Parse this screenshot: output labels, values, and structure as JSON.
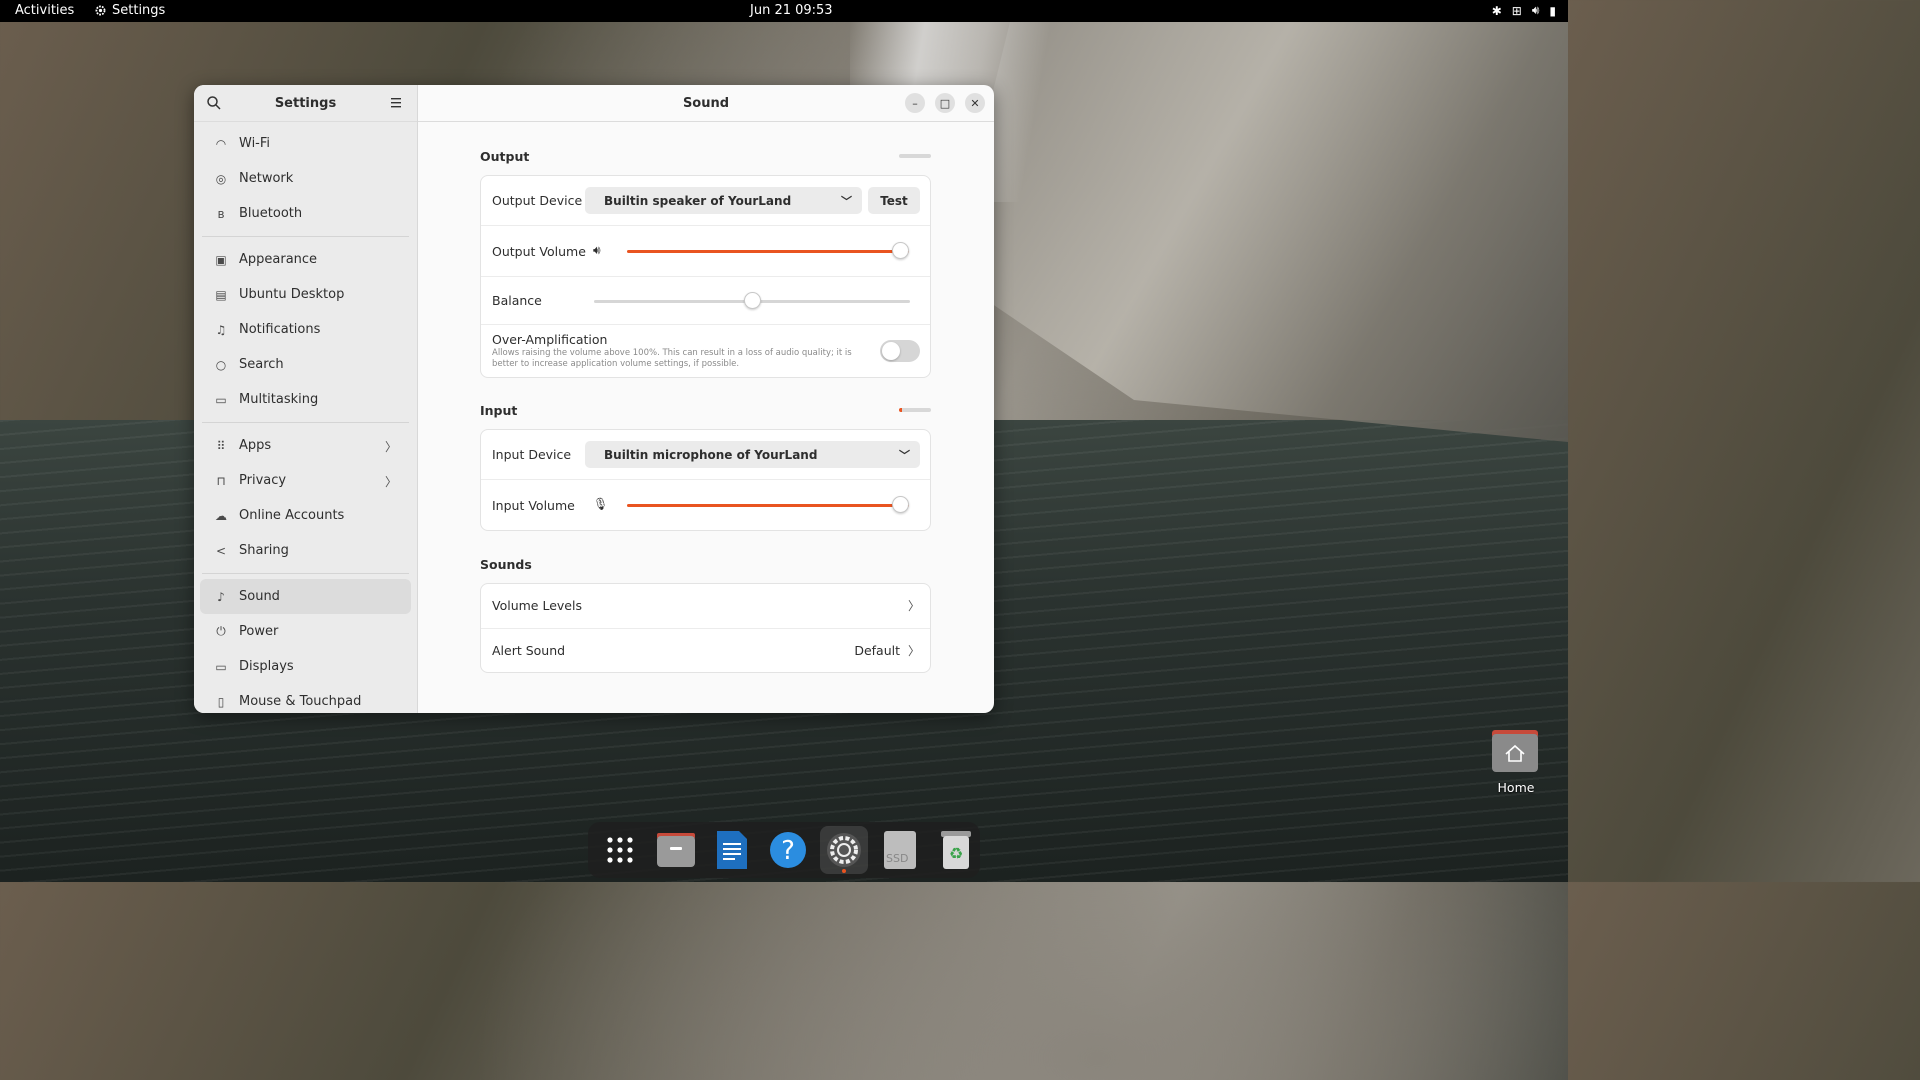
{
  "topbar": {
    "activities": "Activities",
    "app_name": "Settings",
    "clock": "Jun 21  09:53"
  },
  "sidebar": {
    "title": "Settings",
    "items": [
      {
        "label": "Wi-Fi",
        "icon": "wifi-icon"
      },
      {
        "label": "Network",
        "icon": "network-icon"
      },
      {
        "label": "Bluetooth",
        "icon": "bluetooth-icon"
      },
      {
        "label": "Appearance",
        "icon": "appearance-icon"
      },
      {
        "label": "Ubuntu Desktop",
        "icon": "desktop-icon"
      },
      {
        "label": "Notifications",
        "icon": "bell-icon"
      },
      {
        "label": "Search",
        "icon": "search-icon"
      },
      {
        "label": "Multitasking",
        "icon": "multitasking-icon"
      },
      {
        "label": "Apps",
        "icon": "apps-icon"
      },
      {
        "label": "Privacy",
        "icon": "lock-icon"
      },
      {
        "label": "Online Accounts",
        "icon": "cloud-icon"
      },
      {
        "label": "Sharing",
        "icon": "share-icon"
      },
      {
        "label": "Sound",
        "icon": "music-note-icon"
      },
      {
        "label": "Power",
        "icon": "power-icon"
      },
      {
        "label": "Displays",
        "icon": "monitor-icon"
      },
      {
        "label": "Mouse & Touchpad",
        "icon": "mouse-icon"
      }
    ],
    "active_item": "Sound"
  },
  "content": {
    "title": "Sound",
    "output": {
      "section_title": "Output",
      "device_label": "Output Device",
      "device_value": "Builtin speaker of YourLand",
      "test_label": "Test",
      "volume_label": "Output Volume",
      "volume_level": 0.97,
      "balance_label": "Balance",
      "balance_level": 0.5,
      "overamp_label": "Over-Amplification",
      "overamp_desc_line1": "Allows raising the volume above 100%. This can result in a loss of audio quality; it is",
      "overamp_desc_line2": "better to increase application volume settings, if possible.",
      "overamp_enabled": false
    },
    "input": {
      "section_title": "Input",
      "device_label": "Input Device",
      "device_value": "Builtin microphone of YourLand",
      "volume_label": "Input Volume",
      "volume_level": 0.97
    },
    "sounds": {
      "section_title": "Sounds",
      "volume_levels_label": "Volume Levels",
      "alert_sound_label": "Alert Sound",
      "alert_sound_value": "Default"
    }
  },
  "desktop": {
    "home_label": "Home"
  },
  "dock": {
    "items": [
      "app-grid-icon",
      "files-icon",
      "writer-icon",
      "help-icon",
      "settings-icon",
      "ssd-drive-icon",
      "trash-icon"
    ],
    "ssd_text": "SSD"
  },
  "colors": {
    "accent": "#e95420",
    "window_bg": "#fafafa",
    "sidebar_bg": "#ebebeb"
  }
}
